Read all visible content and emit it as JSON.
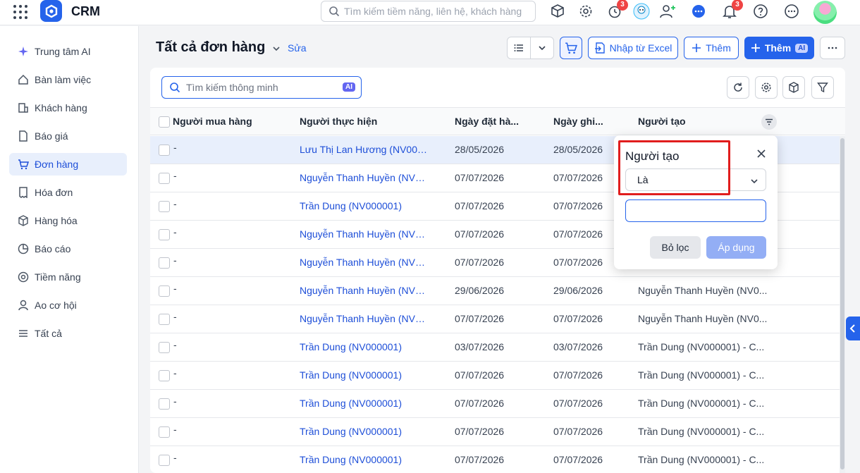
{
  "app": {
    "name": "CRM",
    "search_placeholder": "Tìm kiếm tiềm năng, liên hệ, khách hàng",
    "notifications": {
      "timer_badge": "3",
      "bell_badge": "3"
    }
  },
  "sidebar": {
    "items": [
      {
        "label": "Trung tâm AI",
        "icon": "sparkle-icon"
      },
      {
        "label": "Bàn làm việc",
        "icon": "home-icon"
      },
      {
        "label": "Khách hàng",
        "icon": "building-icon"
      },
      {
        "label": "Báo giá",
        "icon": "document-icon"
      },
      {
        "label": "Đơn hàng",
        "icon": "cart-icon",
        "active": true
      },
      {
        "label": "Hóa đơn",
        "icon": "receipt-icon"
      },
      {
        "label": "Hàng hóa",
        "icon": "box-icon"
      },
      {
        "label": "Báo cáo",
        "icon": "pie-chart-icon"
      },
      {
        "label": "Tiềm năng",
        "icon": "target-icon"
      },
      {
        "label": "Ao cơ hội",
        "icon": "opportunity-icon"
      },
      {
        "label": "Tất cả",
        "icon": "menu-icon"
      }
    ]
  },
  "page": {
    "title": "Tất cả đơn hàng",
    "edit_label": "Sửa",
    "import_label": "Nhập từ Excel",
    "add_label": "Thêm",
    "add_ai_label": "Thêm",
    "ai_chip": "AI"
  },
  "table": {
    "search_placeholder": "Tìm kiếm thông minh",
    "ai_chip": "AI",
    "columns": [
      "Người mua hàng",
      "Người thực hiện",
      "Ngày đặt hà...",
      "Ngày ghi...",
      "Người tạo"
    ],
    "rows": [
      {
        "buyer": "-",
        "assignee": "Lưu Thị Lan Hương (NV000...",
        "order_date": "28/05/2026",
        "record_date": "28/05/2026",
        "creator": ""
      },
      {
        "buyer": "-",
        "assignee": "Nguyễn Thanh Huyền (NV0...",
        "order_date": "07/07/2026",
        "record_date": "07/07/2026",
        "creator": ""
      },
      {
        "buyer": "-",
        "assignee": "Trần Dung (NV000001)",
        "order_date": "07/07/2026",
        "record_date": "07/07/2026",
        "creator": ""
      },
      {
        "buyer": "-",
        "assignee": "Nguyễn Thanh Huyền (NV0...",
        "order_date": "07/07/2026",
        "record_date": "07/07/2026",
        "creator": ""
      },
      {
        "buyer": "-",
        "assignee": "Nguyễn Thanh Huyền (NV0...",
        "order_date": "07/07/2026",
        "record_date": "07/07/2026",
        "creator": ""
      },
      {
        "buyer": "-",
        "assignee": "Nguyễn Thanh Huyền (NV0...",
        "order_date": "29/06/2026",
        "record_date": "29/06/2026",
        "creator": "Nguyễn Thanh Huyền (NV0..."
      },
      {
        "buyer": "-",
        "assignee": "Nguyễn Thanh Huyền (NV0...",
        "order_date": "07/07/2026",
        "record_date": "07/07/2026",
        "creator": "Nguyễn Thanh Huyền (NV0..."
      },
      {
        "buyer": "-",
        "assignee": "Trần Dung (NV000001)",
        "order_date": "03/07/2026",
        "record_date": "03/07/2026",
        "creator": "Trần Dung (NV000001) - C..."
      },
      {
        "buyer": "-",
        "assignee": "Trần Dung (NV000001)",
        "order_date": "07/07/2026",
        "record_date": "07/07/2026",
        "creator": "Trần Dung (NV000001) - C..."
      },
      {
        "buyer": "-",
        "assignee": "Trần Dung (NV000001)",
        "order_date": "07/07/2026",
        "record_date": "07/07/2026",
        "creator": "Trần Dung (NV000001) - C..."
      },
      {
        "buyer": "-",
        "assignee": "Trần Dung (NV000001)",
        "order_date": "07/07/2026",
        "record_date": "07/07/2026",
        "creator": "Trần Dung (NV000001) - C..."
      },
      {
        "buyer": "-",
        "assignee": "Trần Dung (NV000001)",
        "order_date": "07/07/2026",
        "record_date": "07/07/2026",
        "creator": "Trần Dung (NV000001) - C..."
      }
    ]
  },
  "filter_popup": {
    "title": "Người tạo",
    "operator": "Là",
    "value": "",
    "reset_label": "Bỏ lọc",
    "apply_label": "Áp dụng"
  },
  "colors": {
    "accent": "#2563eb",
    "highlight": "#e11d1d"
  }
}
